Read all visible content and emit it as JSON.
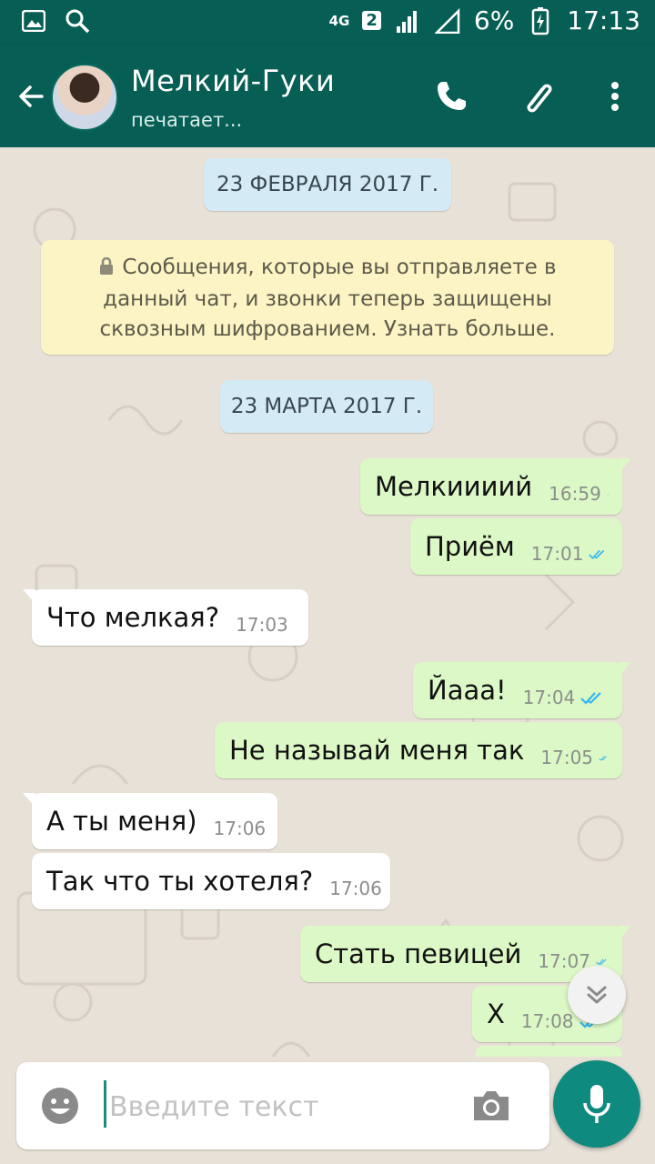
{
  "status_bar": {
    "network": "4G",
    "sim": "2",
    "battery": "6%",
    "time": "17:13"
  },
  "header": {
    "contact_name": "Мелкий-Гуки",
    "contact_status": "печатает...",
    "icons": [
      "back-arrow-icon",
      "phone-icon",
      "attachment-icon",
      "more-vert-icon"
    ]
  },
  "chat": {
    "date_1": "23 ФЕВРАЛЯ 2017 Г.",
    "encryption_notice": "Сообщения, которые вы отправляете в данный чат, и звонки теперь защищены сквозным шифрованием. Узнать больше.",
    "date_2": "23 МАРТА 2017 Г.",
    "messages": [
      {
        "direction": "out",
        "text": "Мелкиииий",
        "time": "16:59",
        "status": "read"
      },
      {
        "direction": "out",
        "text": "Приём",
        "time": "17:01",
        "status": "read"
      },
      {
        "direction": "in",
        "text": "Что мелкая?",
        "time": "17:03"
      },
      {
        "direction": "out",
        "text": "Йааа!",
        "time": "17:04",
        "status": "read"
      },
      {
        "direction": "out",
        "text": "Не называй меня так",
        "time": "17:05",
        "status": "read"
      },
      {
        "direction": "in",
        "text": "А ты меня)",
        "time": "17:06"
      },
      {
        "direction": "in",
        "text": "Так что ты хотеля?",
        "time": "17:06"
      },
      {
        "direction": "out",
        "text": "Стать певицей",
        "time": "17:07",
        "status": "read"
      },
      {
        "direction": "out",
        "text": "Х",
        "time": "17:08",
        "status": "read"
      }
    ]
  },
  "composer": {
    "placeholder": "Введите текст"
  },
  "colors": {
    "header": "#075e54",
    "outgoing_bubble": "#dcf8c6",
    "incoming_bubble": "#ffffff",
    "read_ticks": "#34b7f1",
    "fab": "#0f8a7e"
  }
}
